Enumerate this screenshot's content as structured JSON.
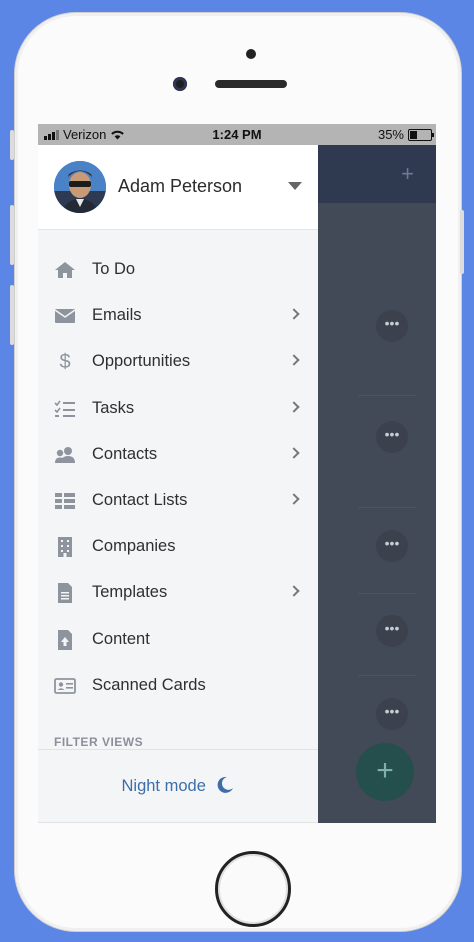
{
  "status_bar": {
    "carrier": "Verizon",
    "time": "1:24 PM",
    "battery": "35%",
    "battery_level": 0.35,
    "icons": [
      "signal-icon",
      "wifi-icon",
      "battery-icon"
    ]
  },
  "profile": {
    "name": "Adam Peterson",
    "icons": [
      "avatar",
      "dropdown-caret-icon"
    ]
  },
  "menu": {
    "items": [
      {
        "label": "To Do",
        "icon": "home-icon",
        "has_chevron": false
      },
      {
        "label": "Emails",
        "icon": "envelope-icon",
        "has_chevron": true
      },
      {
        "label": "Opportunities",
        "icon": "dollar-icon",
        "has_chevron": true
      },
      {
        "label": "Tasks",
        "icon": "checklist-icon",
        "has_chevron": true
      },
      {
        "label": "Contacts",
        "icon": "people-icon",
        "has_chevron": true
      },
      {
        "label": "Contact Lists",
        "icon": "list-icon",
        "has_chevron": true
      },
      {
        "label": "Companies",
        "icon": "building-icon",
        "has_chevron": false
      },
      {
        "label": "Templates",
        "icon": "document-icon",
        "has_chevron": true
      },
      {
        "label": "Content",
        "icon": "file-upload-icon",
        "has_chevron": false
      },
      {
        "label": "Scanned Cards",
        "icon": "id-card-icon",
        "has_chevron": false
      }
    ]
  },
  "filter_views": {
    "heading": "FILTER VIEWS"
  },
  "night_mode": {
    "label": "Night mode",
    "icon": "moon-icon"
  },
  "background_screen": {
    "add_icon": "plus-icon",
    "row_actions": [
      "•••",
      "•••",
      "•••",
      "•••",
      "•••"
    ],
    "fab_label": "+"
  },
  "colors": {
    "background": "#5b86e5",
    "drawer": "#f4f5f7",
    "accent_link": "#3d6ea8",
    "icon_gray": "#8e949e",
    "overlay": "#434a57"
  }
}
